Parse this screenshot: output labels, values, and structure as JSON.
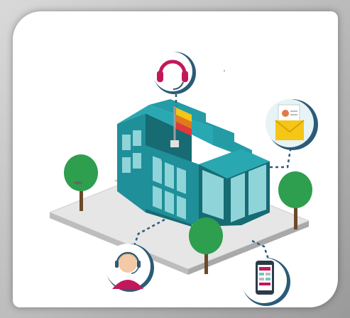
{
  "colors": {
    "frame": "#c4c4c4",
    "card_bg": "#ffffff",
    "building_teal": "#1f8f99",
    "building_dark": "#176b73",
    "window_light": "#8fd4d8",
    "ground": "#e6e6e6",
    "tree_green": "#2e9e4f",
    "tree_trunk": "#6a4a2a",
    "accent_yellow": "#f5c518",
    "accent_red": "#e03a3a",
    "accent_pink": "#c2185b"
  },
  "icons": [
    "headset-icon",
    "mail-icon",
    "phone-icon",
    "support-agent-icon",
    "flag-icon"
  ]
}
